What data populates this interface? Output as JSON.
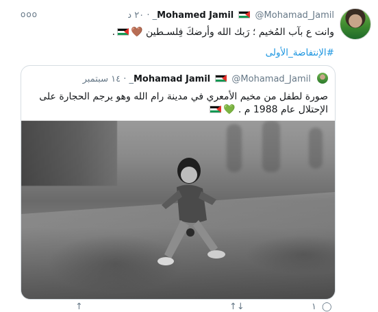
{
  "more_label": "ooo",
  "tweet": {
    "name": "Mohamed Jamil",
    "handle": "@Mohamad_Jamil_",
    "time": "٢٠ د",
    "text": "وانت ع بآب المُخيم ؛ رَبك الله وأرضكَ فِلسـطين",
    "hashtag": "#الإنتفاضة_الأولى"
  },
  "quote": {
    "name": "Mohamad Jamil",
    "handle": "@Mohamad_Jamil_",
    "time": "١٤ سبتمبر",
    "text_line1": "صورة لطفل من مخيم الأمعري في مدينة رام الله وهو يرجم الحجارة على",
    "text_line2": "الإحتلال عام 1988 م ."
  },
  "icons": {
    "heart_brown": "🤎",
    "heart_green": "💚"
  },
  "actions": {
    "reply_count": "١",
    "retweet_label": "↑↓",
    "like_label": "",
    "share_label": "↑"
  },
  "colors": {
    "link": "#1b95e0",
    "secondary": "#657786",
    "border": "#d6dde2"
  }
}
